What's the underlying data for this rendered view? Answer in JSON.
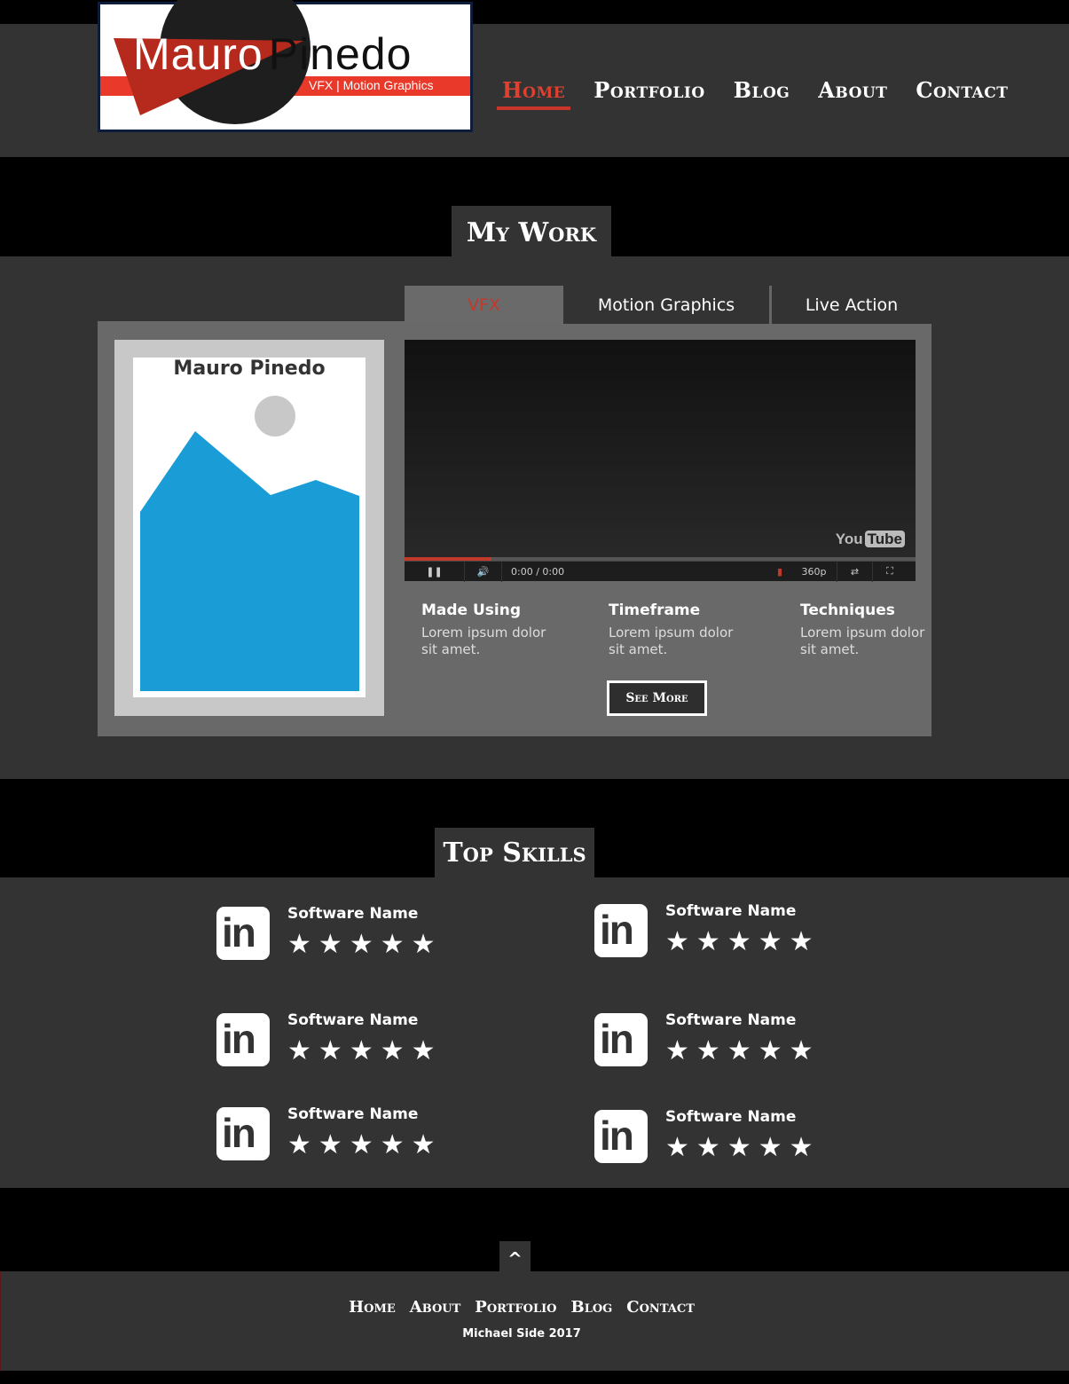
{
  "brand": {
    "first": "Mauro",
    "last": "Pinedo",
    "tagline": "VFX | Motion Graphics",
    "colors": {
      "accent": "#e8392a",
      "dark": "#1e1e1e",
      "nav_active": "#e0402f"
    }
  },
  "nav": {
    "items": [
      "Home",
      "Portfolio",
      "Blog",
      "About",
      "Contact"
    ],
    "active": "Home"
  },
  "work": {
    "title": "My Work",
    "tabs": [
      "VFX",
      "Motion Graphics",
      "Live Action"
    ],
    "active_tab": "VFX",
    "thumbnail_caption": "Mauro Pinedo",
    "video": {
      "logo": "You",
      "logo_box": "Tube",
      "time": "0:00 / 0:00",
      "quality": "360p",
      "progress_fraction": 0.17
    },
    "info": [
      {
        "heading": "Made Using",
        "text": "Lorem ipsum dolor sit amet."
      },
      {
        "heading": "Timeframe",
        "text": "Lorem ipsum dolor sit amet."
      },
      {
        "heading": "Techniques",
        "text": "Lorem ipsum dolor sit amet."
      }
    ],
    "see_more": "See More"
  },
  "skills": {
    "title": "Top Skills",
    "icon": "linkedin-icon",
    "items": [
      {
        "name": "Software Name",
        "rating": 5
      },
      {
        "name": "Software Name",
        "rating": 5
      },
      {
        "name": "Software Name",
        "rating": 5
      },
      {
        "name": "Software Name",
        "rating": 5
      },
      {
        "name": "Software Name",
        "rating": 5
      },
      {
        "name": "Software Name",
        "rating": 5
      }
    ]
  },
  "footer": {
    "back_to_top": "^",
    "nav": [
      "Home",
      "About",
      "Portfolio",
      "Blog",
      "Contact"
    ],
    "credit": "Michael Side 2017"
  }
}
